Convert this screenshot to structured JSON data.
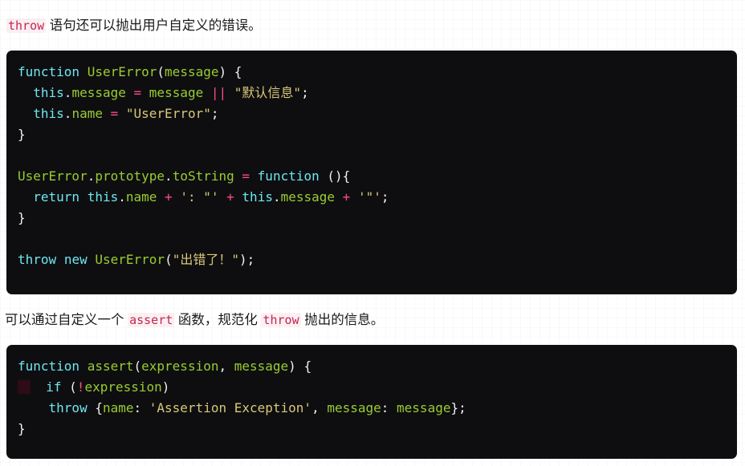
{
  "page": {
    "background_color": "#ffffff",
    "code_background_color": "#0e0e10",
    "inline_code_color": "#c7254e",
    "accent_colors": {
      "keyword": "#6ee7f0",
      "identifier": "#9acd32",
      "string": "#d8c87a",
      "operator": "#ff4b82",
      "punctuation": "#f2f2f2"
    }
  },
  "paragraphs": {
    "first": {
      "code_term": "throw",
      "text": " 语句还可以抛出用户自定义的错误。"
    },
    "second": {
      "prefix": "可以通过自定义一个 ",
      "code_term_1": "assert",
      "middle": " 函数，规范化 ",
      "code_term_2": "throw",
      "suffix": " 抛出的信息。"
    }
  },
  "code_block_1": {
    "language": "javascript",
    "lines": [
      [
        {
          "t": "function",
          "c": "kw"
        },
        {
          "t": " ",
          "c": "punc"
        },
        {
          "t": "UserError",
          "c": "fn"
        },
        {
          "t": "(",
          "c": "punc"
        },
        {
          "t": "message",
          "c": "param"
        },
        {
          "t": ") {",
          "c": "punc"
        }
      ],
      [
        {
          "t": "  ",
          "c": "punc"
        },
        {
          "t": "this",
          "c": "kw"
        },
        {
          "t": ".",
          "c": "dot"
        },
        {
          "t": "message",
          "c": "prop"
        },
        {
          "t": " ",
          "c": "punc"
        },
        {
          "t": "=",
          "c": "op"
        },
        {
          "t": " ",
          "c": "punc"
        },
        {
          "t": "message",
          "c": "prop"
        },
        {
          "t": " ",
          "c": "punc"
        },
        {
          "t": "||",
          "c": "op"
        },
        {
          "t": " ",
          "c": "punc"
        },
        {
          "t": "\"默认信息\"",
          "c": "str"
        },
        {
          "t": ";",
          "c": "punc"
        }
      ],
      [
        {
          "t": "  ",
          "c": "punc"
        },
        {
          "t": "this",
          "c": "kw"
        },
        {
          "t": ".",
          "c": "dot"
        },
        {
          "t": "name",
          "c": "prop"
        },
        {
          "t": " ",
          "c": "punc"
        },
        {
          "t": "=",
          "c": "op"
        },
        {
          "t": " ",
          "c": "punc"
        },
        {
          "t": "\"UserError\"",
          "c": "str"
        },
        {
          "t": ";",
          "c": "punc"
        }
      ],
      [
        {
          "t": "}",
          "c": "punc"
        }
      ],
      [],
      [
        {
          "t": "UserError",
          "c": "fn"
        },
        {
          "t": ".",
          "c": "dot"
        },
        {
          "t": "prototype",
          "c": "fn"
        },
        {
          "t": ".",
          "c": "dot"
        },
        {
          "t": "toString",
          "c": "fn"
        },
        {
          "t": " ",
          "c": "punc"
        },
        {
          "t": "=",
          "c": "op"
        },
        {
          "t": " ",
          "c": "punc"
        },
        {
          "t": "function",
          "c": "kw"
        },
        {
          "t": " (){",
          "c": "punc"
        }
      ],
      [
        {
          "t": "  ",
          "c": "punc"
        },
        {
          "t": "return",
          "c": "kw"
        },
        {
          "t": " ",
          "c": "punc"
        },
        {
          "t": "this",
          "c": "kw"
        },
        {
          "t": ".",
          "c": "dot"
        },
        {
          "t": "name",
          "c": "prop"
        },
        {
          "t": " ",
          "c": "punc"
        },
        {
          "t": "+",
          "c": "op"
        },
        {
          "t": " ",
          "c": "punc"
        },
        {
          "t": "': \"'",
          "c": "str"
        },
        {
          "t": " ",
          "c": "punc"
        },
        {
          "t": "+",
          "c": "op"
        },
        {
          "t": " ",
          "c": "punc"
        },
        {
          "t": "this",
          "c": "kw"
        },
        {
          "t": ".",
          "c": "dot"
        },
        {
          "t": "message",
          "c": "prop"
        },
        {
          "t": " ",
          "c": "punc"
        },
        {
          "t": "+",
          "c": "op"
        },
        {
          "t": " ",
          "c": "punc"
        },
        {
          "t": "'\"'",
          "c": "str"
        },
        {
          "t": ";",
          "c": "punc"
        }
      ],
      [
        {
          "t": "}",
          "c": "punc"
        }
      ],
      [],
      [
        {
          "t": "throw",
          "c": "kw"
        },
        {
          "t": " ",
          "c": "punc"
        },
        {
          "t": "new",
          "c": "kw"
        },
        {
          "t": " ",
          "c": "punc"
        },
        {
          "t": "UserError",
          "c": "fn"
        },
        {
          "t": "(",
          "c": "punc"
        },
        {
          "t": "\"出错了！\"",
          "c": "str"
        },
        {
          "t": ");",
          "c": "punc"
        }
      ]
    ]
  },
  "code_block_2": {
    "language": "javascript",
    "lines": [
      [
        {
          "t": "function",
          "c": "kw"
        },
        {
          "t": " ",
          "c": "punc"
        },
        {
          "t": "assert",
          "c": "fn"
        },
        {
          "t": "(",
          "c": "punc"
        },
        {
          "t": "expression",
          "c": "param"
        },
        {
          "t": ", ",
          "c": "punc"
        },
        {
          "t": "message",
          "c": "param"
        },
        {
          "t": ") {",
          "c": "punc"
        }
      ],
      [
        {
          "t": "",
          "c": "wsmark"
        },
        {
          "t": "  ",
          "c": "punc"
        },
        {
          "t": "if",
          "c": "kw"
        },
        {
          "t": " (",
          "c": "punc"
        },
        {
          "t": "!",
          "c": "op"
        },
        {
          "t": "expression",
          "c": "param"
        },
        {
          "t": ")",
          "c": "punc"
        }
      ],
      [
        {
          "t": "    ",
          "c": "punc"
        },
        {
          "t": "throw",
          "c": "kw"
        },
        {
          "t": " {",
          "c": "punc"
        },
        {
          "t": "name",
          "c": "prop"
        },
        {
          "t": ": ",
          "c": "punc"
        },
        {
          "t": "'Assertion Exception'",
          "c": "str"
        },
        {
          "t": ", ",
          "c": "punc"
        },
        {
          "t": "message",
          "c": "param"
        },
        {
          "t": ": ",
          "c": "punc"
        },
        {
          "t": "message",
          "c": "param"
        },
        {
          "t": "};",
          "c": "punc"
        }
      ],
      [
        {
          "t": "}",
          "c": "punc"
        }
      ]
    ]
  }
}
